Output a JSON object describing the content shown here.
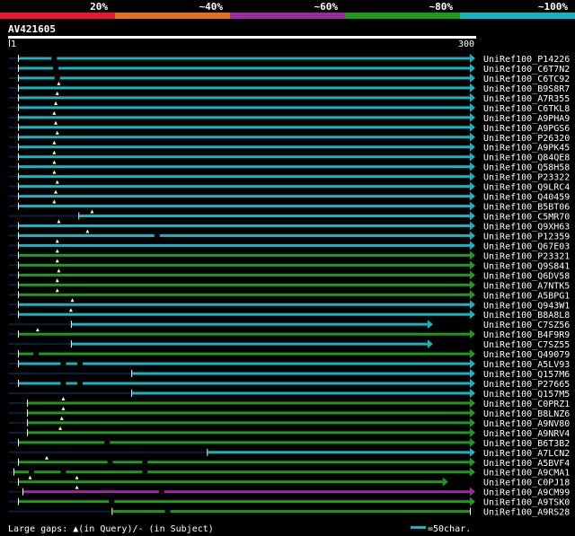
{
  "legend": {
    "bands": [
      {
        "label": "20%",
        "color": "#e8182e"
      },
      {
        "label": "~40%",
        "color": "#e07020"
      },
      {
        "label": "~60%",
        "color": "#9b2c9c"
      },
      {
        "label": "~80%",
        "color": "#1f9a1f"
      },
      {
        "label": "~100%",
        "color": "#17b3c1"
      }
    ]
  },
  "chart_data": {
    "type": "alignment-overview",
    "title": "AV421605",
    "query_start_label": "1",
    "query_end_label": "300",
    "query_length": 300,
    "footer_gaps_label": "Large gaps: ▲(in Query)/- (in Subject)",
    "scale_label": "=50char.",
    "scale_chars": 50,
    "hits": [
      {
        "name": "UniRef100_P14226",
        "color": "cyan",
        "start": 1,
        "end": 300,
        "full": true,
        "q_gaps": [],
        "s_gaps": [
          25
        ]
      },
      {
        "name": "UniRef100_C6T7N2",
        "color": "cyan",
        "start": 1,
        "end": 300,
        "full": true,
        "q_gaps": [],
        "s_gaps": [
          26
        ]
      },
      {
        "name": "UniRef100_C6TC92",
        "color": "cyan",
        "start": 1,
        "end": 300,
        "full": true,
        "q_gaps": [],
        "s_gaps": [
          27
        ]
      },
      {
        "name": "UniRef100_B9S8R7",
        "color": "cyan",
        "start": 1,
        "end": 300,
        "full": true,
        "q_gaps": [
          28
        ],
        "s_gaps": []
      },
      {
        "name": "UniRef100_A7R355",
        "color": "cyan",
        "start": 1,
        "end": 300,
        "full": true,
        "q_gaps": [
          27
        ],
        "s_gaps": []
      },
      {
        "name": "UniRef100_C6TKL8",
        "color": "cyan",
        "start": 1,
        "end": 300,
        "full": true,
        "q_gaps": [
          26
        ],
        "s_gaps": []
      },
      {
        "name": "UniRef100_A9PHA9",
        "color": "cyan",
        "start": 1,
        "end": 300,
        "full": true,
        "q_gaps": [
          25
        ],
        "s_gaps": []
      },
      {
        "name": "UniRef100_A9PGS6",
        "color": "cyan",
        "start": 1,
        "end": 300,
        "full": true,
        "q_gaps": [
          26
        ],
        "s_gaps": []
      },
      {
        "name": "UniRef100_P26320",
        "color": "cyan",
        "start": 1,
        "end": 300,
        "full": true,
        "q_gaps": [
          27
        ],
        "s_gaps": []
      },
      {
        "name": "UniRef100_A9PK45",
        "color": "cyan",
        "start": 1,
        "end": 300,
        "full": true,
        "q_gaps": [
          25
        ],
        "s_gaps": []
      },
      {
        "name": "UniRef100_Q84QE8",
        "color": "cyan",
        "start": 1,
        "end": 300,
        "full": true,
        "q_gaps": [
          25
        ],
        "s_gaps": []
      },
      {
        "name": "UniRef100_Q58H58",
        "color": "cyan",
        "start": 1,
        "end": 300,
        "full": true,
        "q_gaps": [
          25
        ],
        "s_gaps": []
      },
      {
        "name": "UniRef100_P23322",
        "color": "cyan",
        "start": 1,
        "end": 300,
        "full": true,
        "q_gaps": [
          25
        ],
        "s_gaps": []
      },
      {
        "name": "UniRef100_Q9LRC4",
        "color": "cyan",
        "start": 1,
        "end": 300,
        "full": true,
        "q_gaps": [
          27
        ],
        "s_gaps": []
      },
      {
        "name": "UniRef100_Q40459",
        "color": "cyan",
        "start": 1,
        "end": 300,
        "full": true,
        "q_gaps": [
          26
        ],
        "s_gaps": []
      },
      {
        "name": "UniRef100_B5BT06",
        "color": "cyan",
        "start": 1,
        "end": 300,
        "full": true,
        "q_gaps": [
          25
        ],
        "s_gaps": []
      },
      {
        "name": "UniRef100_C5MR70",
        "color": "cyan",
        "start": 41,
        "end": 300,
        "full": true,
        "q_gaps": [
          50
        ],
        "s_gaps": []
      },
      {
        "name": "UniRef100_Q9XH63",
        "color": "cyan",
        "start": 1,
        "end": 300,
        "full": true,
        "q_gaps": [
          28
        ],
        "s_gaps": []
      },
      {
        "name": "UniRef100_P12359",
        "color": "cyan",
        "start": 1,
        "end": 300,
        "full": true,
        "q_gaps": [
          47
        ],
        "s_gaps": [
          93
        ]
      },
      {
        "name": "UniRef100_Q67E03",
        "color": "cyan",
        "start": 1,
        "end": 300,
        "full": true,
        "q_gaps": [
          27
        ],
        "s_gaps": []
      },
      {
        "name": "UniRef100_P23321",
        "color": "green",
        "start": 1,
        "end": 300,
        "full": true,
        "q_gaps": [
          27
        ],
        "s_gaps": []
      },
      {
        "name": "UniRef100_Q9S841",
        "color": "green",
        "start": 1,
        "end": 300,
        "full": true,
        "q_gaps": [
          27
        ],
        "s_gaps": []
      },
      {
        "name": "UniRef100_Q6DV58",
        "color": "green",
        "start": 1,
        "end": 300,
        "full": true,
        "q_gaps": [
          28
        ],
        "s_gaps": []
      },
      {
        "name": "UniRef100_A7NTK5",
        "color": "green",
        "start": 1,
        "end": 300,
        "full": true,
        "q_gaps": [
          27
        ],
        "s_gaps": []
      },
      {
        "name": "UniRef100_A5BPG1",
        "color": "green",
        "start": 1,
        "end": 300,
        "full": true,
        "q_gaps": [
          27
        ],
        "s_gaps": []
      },
      {
        "name": "UniRef100_Q943W1",
        "color": "cyan",
        "start": 1,
        "end": 300,
        "full": true,
        "q_gaps": [
          37
        ],
        "s_gaps": []
      },
      {
        "name": "UniRef100_B8A8L8",
        "color": "cyan",
        "start": 1,
        "end": 300,
        "full": true,
        "q_gaps": [
          36
        ],
        "s_gaps": []
      },
      {
        "name": "UniRef100_C7SZ56",
        "color": "cyan",
        "start": 36,
        "end": 272,
        "full": true,
        "q_gaps": [],
        "s_gaps": []
      },
      {
        "name": "UniRef100_B4F9R9",
        "color": "green",
        "start": 1,
        "end": 300,
        "full": true,
        "q_gaps": [
          14
        ],
        "s_gaps": []
      },
      {
        "name": "UniRef100_C7SZ55",
        "color": "cyan",
        "start": 36,
        "end": 272,
        "full": true,
        "q_gaps": [],
        "s_gaps": []
      },
      {
        "name": "UniRef100_Q49079",
        "color": "green",
        "start": 1,
        "end": 300,
        "full": true,
        "q_gaps": [],
        "s_gaps": [
          13
        ]
      },
      {
        "name": "UniRef100_A5LV93",
        "color": "cyan",
        "start": 1,
        "end": 300,
        "full": true,
        "q_gaps": [],
        "s_gaps": [
          31,
          42
        ]
      },
      {
        "name": "UniRef100_Q157M6",
        "color": "cyan",
        "start": 76,
        "end": 300,
        "full": true,
        "q_gaps": [],
        "s_gaps": []
      },
      {
        "name": "UniRef100_P27665",
        "color": "cyan",
        "start": 1,
        "end": 300,
        "full": true,
        "q_gaps": [],
        "s_gaps": [
          31,
          42
        ]
      },
      {
        "name": "UniRef100_Q157M5",
        "color": "cyan",
        "start": 76,
        "end": 300,
        "full": true,
        "q_gaps": [],
        "s_gaps": []
      },
      {
        "name": "UniRef100_C0PRZ1",
        "color": "green",
        "start": 7,
        "end": 300,
        "full": true,
        "q_gaps": [
          31
        ],
        "s_gaps": []
      },
      {
        "name": "UniRef100_B8LNZ6",
        "color": "green",
        "start": 7,
        "end": 300,
        "full": true,
        "q_gaps": [
          31
        ],
        "s_gaps": []
      },
      {
        "name": "UniRef100_A9NV80",
        "color": "green",
        "start": 7,
        "end": 300,
        "full": true,
        "q_gaps": [
          30
        ],
        "s_gaps": []
      },
      {
        "name": "UniRef100_A9NRV4",
        "color": "green",
        "start": 7,
        "end": 300,
        "full": true,
        "q_gaps": [
          29
        ],
        "s_gaps": []
      },
      {
        "name": "UniRef100_B6T3B2",
        "color": "green",
        "start": 1,
        "end": 300,
        "full": true,
        "q_gaps": [],
        "s_gaps": [
          60
        ]
      },
      {
        "name": "UniRef100_A7LCN2",
        "color": "cyan",
        "start": 126,
        "end": 300,
        "full": true,
        "q_gaps": [],
        "s_gaps": []
      },
      {
        "name": "UniRef100_A5BVF4",
        "color": "green",
        "start": 1,
        "end": 300,
        "full": true,
        "q_gaps": [
          20
        ],
        "s_gaps": [
          62,
          85
        ]
      },
      {
        "name": "UniRef100_A9CMA1",
        "color": "green",
        "start": -2,
        "end": 300,
        "full": true,
        "q_gaps": [],
        "s_gaps": [
          10,
          31,
          85
        ]
      },
      {
        "name": "UniRef100_C0PJ18",
        "color": "green",
        "start": 1,
        "end": 282,
        "full": true,
        "q_gaps": [
          9,
          40
        ],
        "s_gaps": []
      },
      {
        "name": "UniRef100_A9CM99",
        "color": "purple",
        "start": 4,
        "end": 300,
        "full": true,
        "q_gaps": [
          40
        ],
        "s_gaps": [
          96
        ]
      },
      {
        "name": "UniRef100_A9TSK0",
        "color": "green",
        "start": 1,
        "end": 300,
        "full": true,
        "q_gaps": [],
        "s_gaps": [
          63
        ]
      },
      {
        "name": "UniRef100_A9RS28",
        "color": "green",
        "start": 63,
        "end": 300,
        "full": false,
        "q_gaps": [],
        "s_gaps": [
          100
        ]
      }
    ]
  }
}
